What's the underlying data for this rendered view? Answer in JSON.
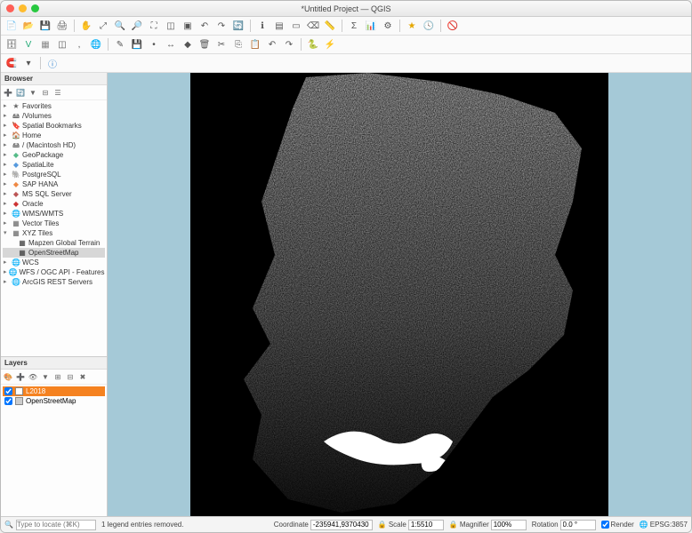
{
  "title": "*Untitled Project — QGIS",
  "browser": {
    "header": "Browser",
    "items": [
      {
        "label": "Favorites",
        "icon": "★",
        "expand": "▸"
      },
      {
        "label": "/Volumes",
        "icon": "🖴",
        "expand": "▸"
      },
      {
        "label": "Spatial Bookmarks",
        "icon": "🔖",
        "expand": "▸"
      },
      {
        "label": "Home",
        "icon": "🏠",
        "expand": "▸"
      },
      {
        "label": "/ (Macintosh HD)",
        "icon": "🖴",
        "expand": "▸"
      },
      {
        "label": "GeoPackage",
        "icon": "◆",
        "expand": "▸",
        "color": "#5b8"
      },
      {
        "label": "SpatiaLite",
        "icon": "◆",
        "expand": "▸",
        "color": "#59d"
      },
      {
        "label": "PostgreSQL",
        "icon": "🐘",
        "expand": "▸"
      },
      {
        "label": "SAP HANA",
        "icon": "◆",
        "expand": "▸",
        "color": "#e84"
      },
      {
        "label": "MS SQL Server",
        "icon": "◆",
        "expand": "▸",
        "color": "#b55"
      },
      {
        "label": "Oracle",
        "icon": "◆",
        "expand": "▸",
        "color": "#c33"
      },
      {
        "label": "WMS/WMTS",
        "icon": "🌐",
        "expand": "▸"
      },
      {
        "label": "Vector Tiles",
        "icon": "▦",
        "expand": "▸"
      },
      {
        "label": "XYZ Tiles",
        "icon": "▦",
        "expand": "▾",
        "children": [
          {
            "label": "Mapzen Global Terrain",
            "icon": "▦"
          },
          {
            "label": "OpenStreetMap",
            "icon": "▦",
            "selected": true
          }
        ]
      },
      {
        "label": "WCS",
        "icon": "🌐",
        "expand": "▸"
      },
      {
        "label": "WFS / OGC API - Features",
        "icon": "🌐",
        "expand": "▸"
      },
      {
        "label": "ArcGIS REST Servers",
        "icon": "🌐",
        "expand": "▸"
      }
    ]
  },
  "layers": {
    "header": "Layers",
    "items": [
      {
        "label": "L2018",
        "checked": true,
        "active": true,
        "swatch": "#ffffff"
      },
      {
        "label": "OpenStreetMap",
        "checked": true,
        "active": false,
        "swatch": "#cccccc"
      }
    ]
  },
  "status": {
    "locate_placeholder": "Type to locate (⌘K)",
    "message": "1 legend entries removed.",
    "coord_label": "Coordinate",
    "coord_value": "-235941,9370430",
    "scale_label": "Scale",
    "scale_value": "1:5510",
    "mag_label": "Magnifier",
    "mag_value": "100%",
    "rot_label": "Rotation",
    "rot_value": "0.0 °",
    "render_label": "Render",
    "crs": "EPSG:3857"
  }
}
